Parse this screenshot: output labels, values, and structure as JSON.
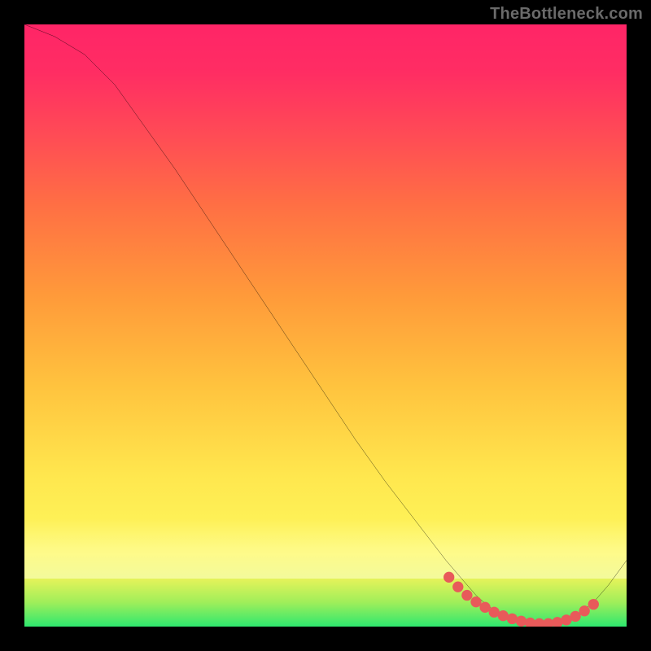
{
  "watermark": "TheBottleneck.com",
  "chart_data": {
    "type": "line",
    "title": "",
    "xlabel": "",
    "ylabel": "",
    "xlim": [
      0,
      100
    ],
    "ylim": [
      0,
      100
    ],
    "annotations": [],
    "series": [
      {
        "name": "curve",
        "color": "#000000",
        "x": [
          0,
          5,
          10,
          15,
          20,
          25,
          30,
          35,
          40,
          45,
          50,
          55,
          60,
          65,
          70,
          73,
          75,
          77,
          79,
          81,
          83,
          85,
          87,
          89,
          91,
          93,
          95,
          97,
          100
        ],
        "y": [
          100,
          98,
          95,
          90,
          83,
          76,
          68.5,
          61,
          53.5,
          46,
          38.5,
          31,
          24,
          17.5,
          11,
          7.5,
          5.2,
          3.4,
          2.1,
          1.2,
          0.6,
          0.3,
          0.3,
          0.7,
          1.5,
          2.8,
          4.6,
          6.9,
          11
        ]
      },
      {
        "name": "dots",
        "color": "#e85a5a",
        "marker": "circle",
        "x": [
          70.5,
          72,
          73.5,
          75,
          76.5,
          78,
          79.5,
          81,
          82.5,
          84,
          85.5,
          87,
          88.5,
          90,
          91.5,
          93,
          94.5
        ],
        "y": [
          8.2,
          6.6,
          5.2,
          4.1,
          3.2,
          2.4,
          1.8,
          1.3,
          0.9,
          0.6,
          0.5,
          0.5,
          0.7,
          1.1,
          1.7,
          2.6,
          3.7
        ]
      }
    ]
  }
}
